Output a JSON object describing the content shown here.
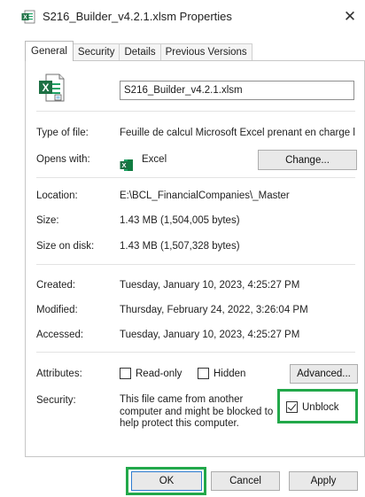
{
  "window": {
    "title": "S216_Builder_v4.2.1.xlsm Properties",
    "close_glyph": "✕"
  },
  "tabs": [
    {
      "label": "General",
      "active": true
    },
    {
      "label": "Security",
      "active": false
    },
    {
      "label": "Details",
      "active": false
    },
    {
      "label": "Previous Versions",
      "active": false
    }
  ],
  "general": {
    "file_icon": "excel-macro-file-icon",
    "filename": "S216_Builder_v4.2.1.xlsm",
    "type_label": "Type of file:",
    "type_value": "Feuille de calcul Microsoft Excel prenant en charge l",
    "opens_label": "Opens with:",
    "opens_app": "Excel",
    "change_button": "Change...",
    "location_label": "Location:",
    "location_value": "E:\\BCL_FinancialCompanies\\_Master",
    "size_label": "Size:",
    "size_value": "1.43 MB (1,504,005 bytes)",
    "size_on_disk_label": "Size on disk:",
    "size_on_disk_value": "1.43 MB (1,507,328 bytes)",
    "created_label": "Created:",
    "created_value": "Tuesday, January 10, 2023, 4:25:27 PM",
    "modified_label": "Modified:",
    "modified_value": "Thursday, February 24, 2022, 3:26:04 PM",
    "accessed_label": "Accessed:",
    "accessed_value": "Tuesday, January 10, 2023, 4:25:27 PM",
    "attributes_label": "Attributes:",
    "readonly_label": "Read-only",
    "readonly_checked": false,
    "hidden_label": "Hidden",
    "hidden_checked": false,
    "advanced_button": "Advanced...",
    "security_label": "Security:",
    "security_message": "This file came from another computer and might be blocked to help protect this computer.",
    "unblock_label": "Unblock",
    "unblock_checked": true
  },
  "footer": {
    "ok_button": "OK",
    "cancel_button": "Cancel",
    "apply_button": "Apply"
  },
  "colors": {
    "highlight": "#22a84a",
    "excel_green": "#1d7044",
    "focus_blue": "#2e7bd1"
  }
}
